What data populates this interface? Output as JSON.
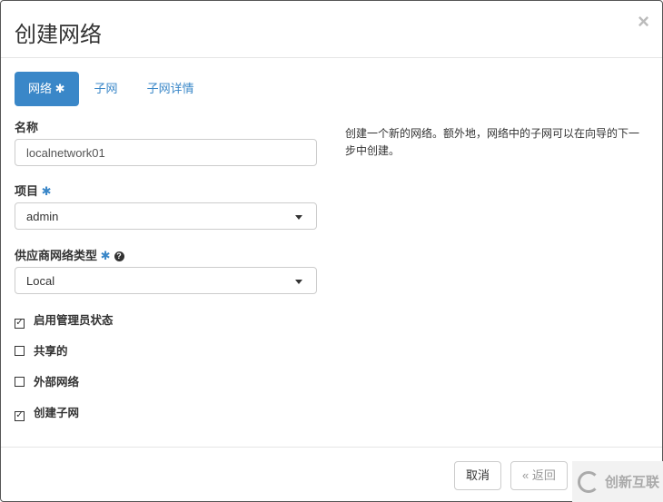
{
  "dialog": {
    "title": "创建网络",
    "close": "×"
  },
  "tabs": [
    {
      "label": "网络",
      "required": "✱"
    },
    {
      "label": "子网"
    },
    {
      "label": "子网详情"
    }
  ],
  "fields": {
    "name": {
      "label": "名称",
      "value": "localnetwork01"
    },
    "project": {
      "label": "项目",
      "required": "✱",
      "value": "admin"
    },
    "provider_type": {
      "label": "供应商网络类型",
      "required": "✱",
      "help_icon": "?",
      "value": "Local"
    }
  },
  "checkboxes": [
    {
      "label": "启用管理员状态",
      "checked": true,
      "mark": "✓"
    },
    {
      "label": "共享的",
      "checked": false,
      "mark": ""
    },
    {
      "label": "外部网络",
      "checked": false,
      "mark": ""
    },
    {
      "label": "创建子网",
      "checked": true,
      "mark": "✓"
    }
  ],
  "help_text": "创建一个新的网络。额外地，网络中的子网可以在向导的下一步中创建。",
  "footer": {
    "cancel": "取消",
    "back": "« 返回"
  },
  "watermark": {
    "text": "创新互联"
  }
}
